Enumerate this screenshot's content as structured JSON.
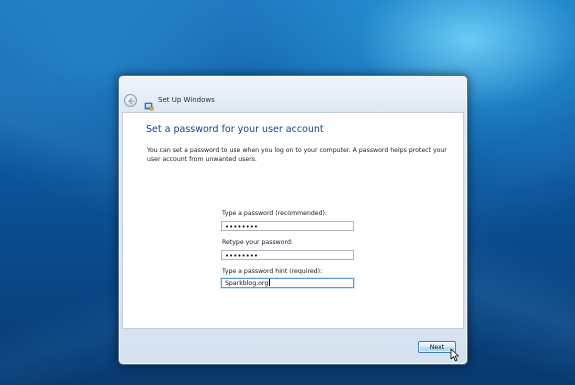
{
  "window": {
    "title": "Set Up Windows"
  },
  "content": {
    "heading": "Set a password for your user account",
    "description": "You can set a password to use when you log on to your computer. A password helps protect your user account from unwanted users."
  },
  "fields": {
    "password": {
      "label": "Type a password (recommended):",
      "value": "••••••••"
    },
    "retype": {
      "label": "Retype your password:",
      "value": "••••••••"
    },
    "hint": {
      "label": "Type a password hint (required):",
      "value": "Sparkblog.org"
    }
  },
  "footer": {
    "next_label": "Next"
  },
  "icons": {
    "back": "back-arrow-icon",
    "setup": "windows-setup-icon",
    "cursor": "mouse-pointer-icon"
  },
  "colors": {
    "heading": "#1c3d8c",
    "desktop_background": "#0d5aa3",
    "focus_border": "#5b9bd5"
  }
}
